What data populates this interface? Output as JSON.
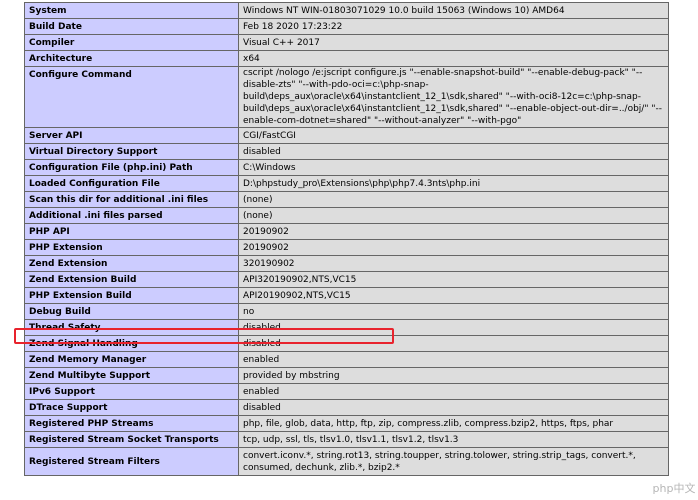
{
  "rows": [
    {
      "label": "System",
      "value": "Windows NT WIN-01803071029 10.0 build 15063 (Windows 10) AMD64"
    },
    {
      "label": "Build Date",
      "value": "Feb 18 2020 17:23:22"
    },
    {
      "label": "Compiler",
      "value": "Visual C++ 2017"
    },
    {
      "label": "Architecture",
      "value": "x64"
    },
    {
      "label": "Configure Command",
      "value": "cscript /nologo /e:jscript configure.js \"--enable-snapshot-build\" \"--enable-debug-pack\" \"--disable-zts\" \"--with-pdo-oci=c:\\php-snap-build\\deps_aux\\oracle\\x64\\instantclient_12_1\\sdk,shared\" \"--with-oci8-12c=c:\\php-snap-build\\deps_aux\\oracle\\x64\\instantclient_12_1\\sdk,shared\" \"--enable-object-out-dir=../obj/\" \"--enable-com-dotnet=shared\" \"--without-analyzer\" \"--with-pgo\""
    },
    {
      "label": "Server API",
      "value": "CGI/FastCGI"
    },
    {
      "label": "Virtual Directory Support",
      "value": "disabled"
    },
    {
      "label": "Configuration File (php.ini) Path",
      "value": "C:\\Windows"
    },
    {
      "label": "Loaded Configuration File",
      "value": "D:\\phpstudy_pro\\Extensions\\php\\php7.4.3nts\\php.ini"
    },
    {
      "label": "Scan this dir for additional .ini files",
      "value": "(none)"
    },
    {
      "label": "Additional .ini files parsed",
      "value": "(none)"
    },
    {
      "label": "PHP API",
      "value": "20190902"
    },
    {
      "label": "PHP Extension",
      "value": "20190902"
    },
    {
      "label": "Zend Extension",
      "value": "320190902"
    },
    {
      "label": "Zend Extension Build",
      "value": "API320190902,NTS,VC15"
    },
    {
      "label": "PHP Extension Build",
      "value": "API20190902,NTS,VC15"
    },
    {
      "label": "Debug Build",
      "value": "no"
    },
    {
      "label": "Thread Safety",
      "value": "disabled"
    },
    {
      "label": "Zend Signal Handling",
      "value": "disabled"
    },
    {
      "label": "Zend Memory Manager",
      "value": "enabled"
    },
    {
      "label": "Zend Multibyte Support",
      "value": "provided by mbstring"
    },
    {
      "label": "IPv6 Support",
      "value": "enabled"
    },
    {
      "label": "DTrace Support",
      "value": "disabled"
    },
    {
      "label": "Registered PHP Streams",
      "value": "php, file, glob, data, http, ftp, zip, compress.zlib, compress.bzip2, https, ftps, phar"
    },
    {
      "label": "Registered Stream Socket Transports",
      "value": "tcp, udp, ssl, tls, tlsv1.0, tlsv1.1, tlsv1.2, tlsv1.3"
    },
    {
      "label": "Registered Stream Filters",
      "value": "convert.iconv.*, string.rot13, string.toupper, string.tolower, string.strip_tags, convert.*, consumed, dechunk, zlib.*, bzip2.*"
    }
  ],
  "highlight_color": "#e8232d",
  "watermark": "php中文网"
}
